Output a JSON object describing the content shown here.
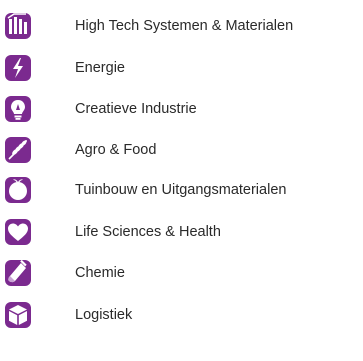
{
  "accent_color": "#7b2a8f",
  "sectors": [
    {
      "label": "High Tech Systemen & Materialen",
      "icon": "chip-icon"
    },
    {
      "label": "Energie",
      "icon": "lightning-icon"
    },
    {
      "label": "Creatieve Industrie",
      "icon": "lightbulb-icon"
    },
    {
      "label": "Agro & Food",
      "icon": "wheat-icon"
    },
    {
      "label": "Tuinbouw en Uitgangsmaterialen",
      "icon": "seed-icon"
    },
    {
      "label": "Life Sciences & Health",
      "icon": "heart-icon"
    },
    {
      "label": "Chemie",
      "icon": "flask-icon"
    },
    {
      "label": "Logistiek",
      "icon": "box-icon"
    }
  ]
}
